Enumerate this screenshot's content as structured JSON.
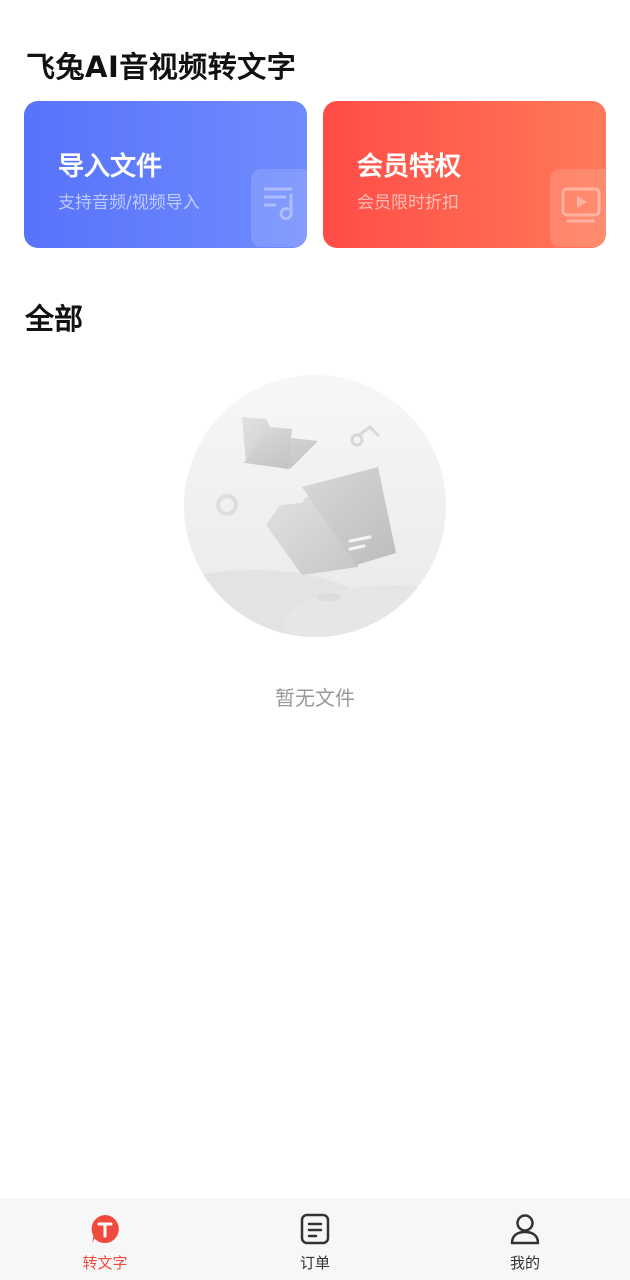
{
  "header": {
    "title": "飞兔AI音视频转文字"
  },
  "cards": {
    "import": {
      "title": "导入文件",
      "subtitle": "支持音频/视频导入"
    },
    "vip": {
      "title": "会员特权",
      "subtitle": "会员限时折扣"
    }
  },
  "section": {
    "title": "全部"
  },
  "empty": {
    "text": "暂无文件"
  },
  "nav": {
    "items": [
      {
        "label": "转文字",
        "icon": "t-bubble-icon",
        "active": true
      },
      {
        "label": "订单",
        "icon": "order-list-icon",
        "active": false
      },
      {
        "label": "我的",
        "icon": "user-icon",
        "active": false
      }
    ]
  },
  "colors": {
    "accent": "#f04a3f",
    "import_card": "#5773fb",
    "vip_card": "#ff4c47"
  }
}
